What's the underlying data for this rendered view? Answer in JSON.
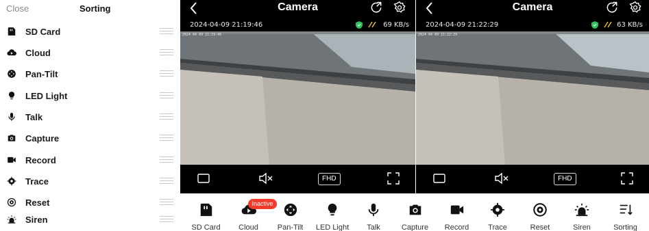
{
  "sorting_panel": {
    "close_label": "Close",
    "title": "Sorting",
    "items": [
      {
        "label": "SD Card",
        "icon": "sd-card-icon"
      },
      {
        "label": "Cloud",
        "icon": "cloud-icon"
      },
      {
        "label": "Pan-Tilt",
        "icon": "pan-tilt-icon"
      },
      {
        "label": "LED Light",
        "icon": "led-light-icon"
      },
      {
        "label": "Talk",
        "icon": "microphone-icon"
      },
      {
        "label": "Capture",
        "icon": "camera-icon"
      },
      {
        "label": "Record",
        "icon": "video-record-icon"
      },
      {
        "label": "Trace",
        "icon": "trace-icon"
      },
      {
        "label": "Reset",
        "icon": "reset-icon"
      },
      {
        "label": "Siren",
        "icon": "siren-icon"
      }
    ]
  },
  "pane_left": {
    "title": "Camera",
    "timestamp": "2024-04-09 21:19:46",
    "speed": "69 KB/s",
    "osd": "2024 04 09 21:19:46",
    "quality": "FHD"
  },
  "pane_right": {
    "title": "Camera",
    "timestamp": "2024-04-09 21:22:29",
    "speed": "63 KB/s",
    "osd": "2024 04 09 21:22:29",
    "quality": "FHD"
  },
  "toolbar": {
    "cloud_badge": "Inactive",
    "items": [
      {
        "label": "SD Card",
        "icon": "sd-card-icon"
      },
      {
        "label": "Cloud",
        "icon": "cloud-icon"
      },
      {
        "label": "Pan-Tilt",
        "icon": "pan-tilt-icon"
      },
      {
        "label": "LED Light",
        "icon": "led-light-icon"
      },
      {
        "label": "Talk",
        "icon": "microphone-icon"
      },
      {
        "label": "Capture",
        "icon": "camera-icon"
      },
      {
        "label": "Record",
        "icon": "video-record-icon"
      },
      {
        "label": "Trace",
        "icon": "trace-icon"
      },
      {
        "label": "Reset",
        "icon": "reset-icon"
      },
      {
        "label": "Siren",
        "icon": "siren-icon"
      },
      {
        "label": "Sorting",
        "icon": "sorting-icon"
      }
    ]
  },
  "colors": {
    "accent_red": "#f23b2b",
    "shield_green": "#2fbf5b",
    "speed_yellow": "#f2c230"
  }
}
